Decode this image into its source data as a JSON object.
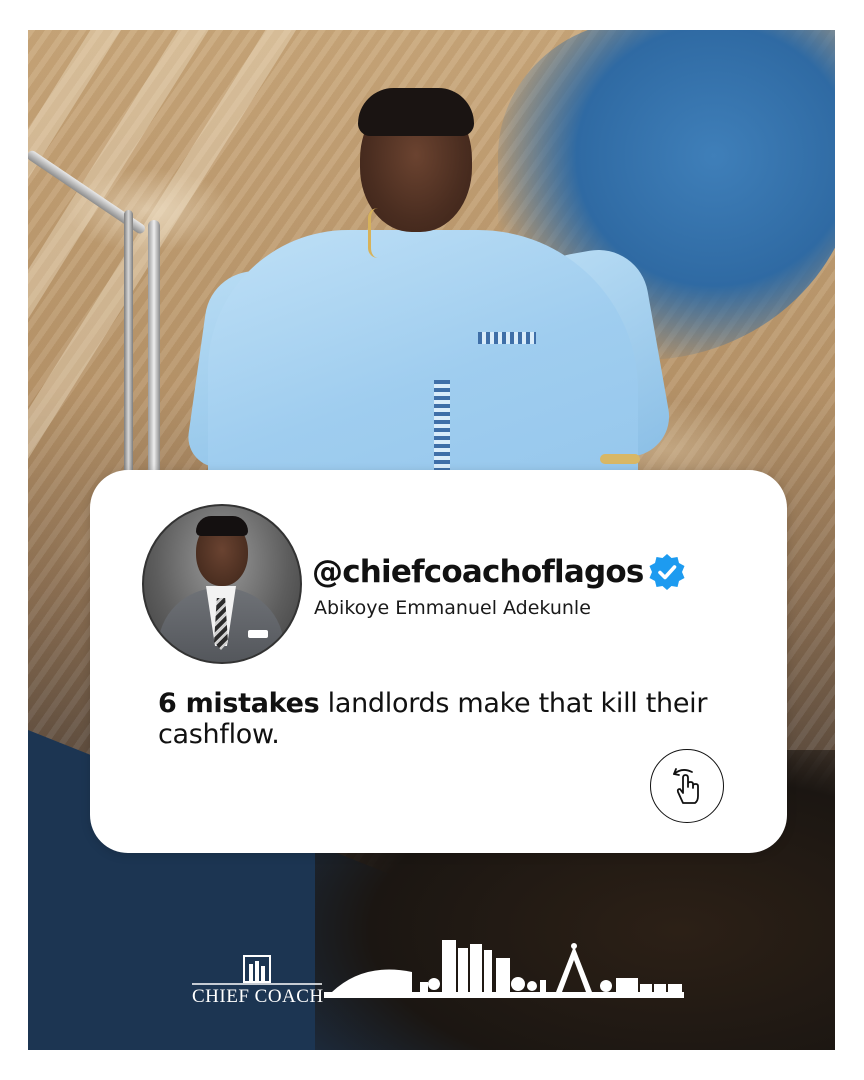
{
  "post": {
    "handle": "@chiefcoachoflagos",
    "name": "Abikoye Emmanuel Adekunle",
    "text_bold": "6 mistakes",
    "text_rest": " landlords make that kill their cashflow."
  },
  "icons": {
    "verified": "verified-badge-icon",
    "swipe": "swipe-hand-icon"
  },
  "brand": {
    "logo_text": "CHIEF COACH"
  },
  "colors": {
    "verified_blue": "#1d9bf0",
    "card_bg": "#ffffff",
    "navy": "#1c3552"
  }
}
